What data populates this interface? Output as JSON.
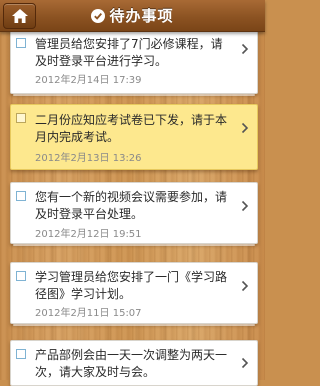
{
  "header": {
    "title": "待办事项",
    "home_icon": "home-icon",
    "title_icon": "check-circle-icon"
  },
  "items": [
    {
      "message": "管理员给您安排了7门必修课程，请及时登录平台进行学习。",
      "date": "2012年2月14日 17:39",
      "highlighted": false
    },
    {
      "message": "二月份应知应考试卷已下发，请于本月内完成考试。",
      "date": "2012年2月13日 13:26",
      "highlighted": true
    },
    {
      "message": "您有一个新的视频会议需要参加，请及时登录平台处理。",
      "date": "2012年2月12日 19:51",
      "highlighted": false
    },
    {
      "message": "学习管理员给您安排了一门《学习路径图》学习计划。",
      "date": "2012年2月11日 15:07",
      "highlighted": false
    },
    {
      "message": "产品部例会由一天一次调整为两天一次，请大家及时与会。",
      "date": "",
      "highlighted": false
    }
  ],
  "colors": {
    "header": "#8c5322",
    "highlight": "#fde88e",
    "wood": "#d19a5a"
  }
}
